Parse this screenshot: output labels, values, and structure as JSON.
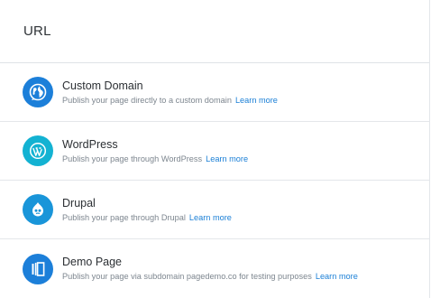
{
  "header": {
    "title": "URL"
  },
  "options": [
    {
      "title": "Custom Domain",
      "description": "Publish your page directly to a custom domain",
      "learn_more": "Learn more",
      "icon": "globe-icon",
      "color": "#1c7fd9"
    },
    {
      "title": "WordPress",
      "description": "Publish your page through WordPress",
      "learn_more": "Learn more",
      "icon": "wordpress-icon",
      "color": "#13b2d2"
    },
    {
      "title": "Drupal",
      "description": "Publish your page through Drupal",
      "learn_more": "Learn more",
      "icon": "drupal-icon",
      "color": "#1995d9"
    },
    {
      "title": "Demo Page",
      "description": "Publish your page via subdomain pagedemo.co for testing purposes",
      "learn_more": "Learn more",
      "icon": "pages-icon",
      "color": "#1c7fd9"
    }
  ]
}
